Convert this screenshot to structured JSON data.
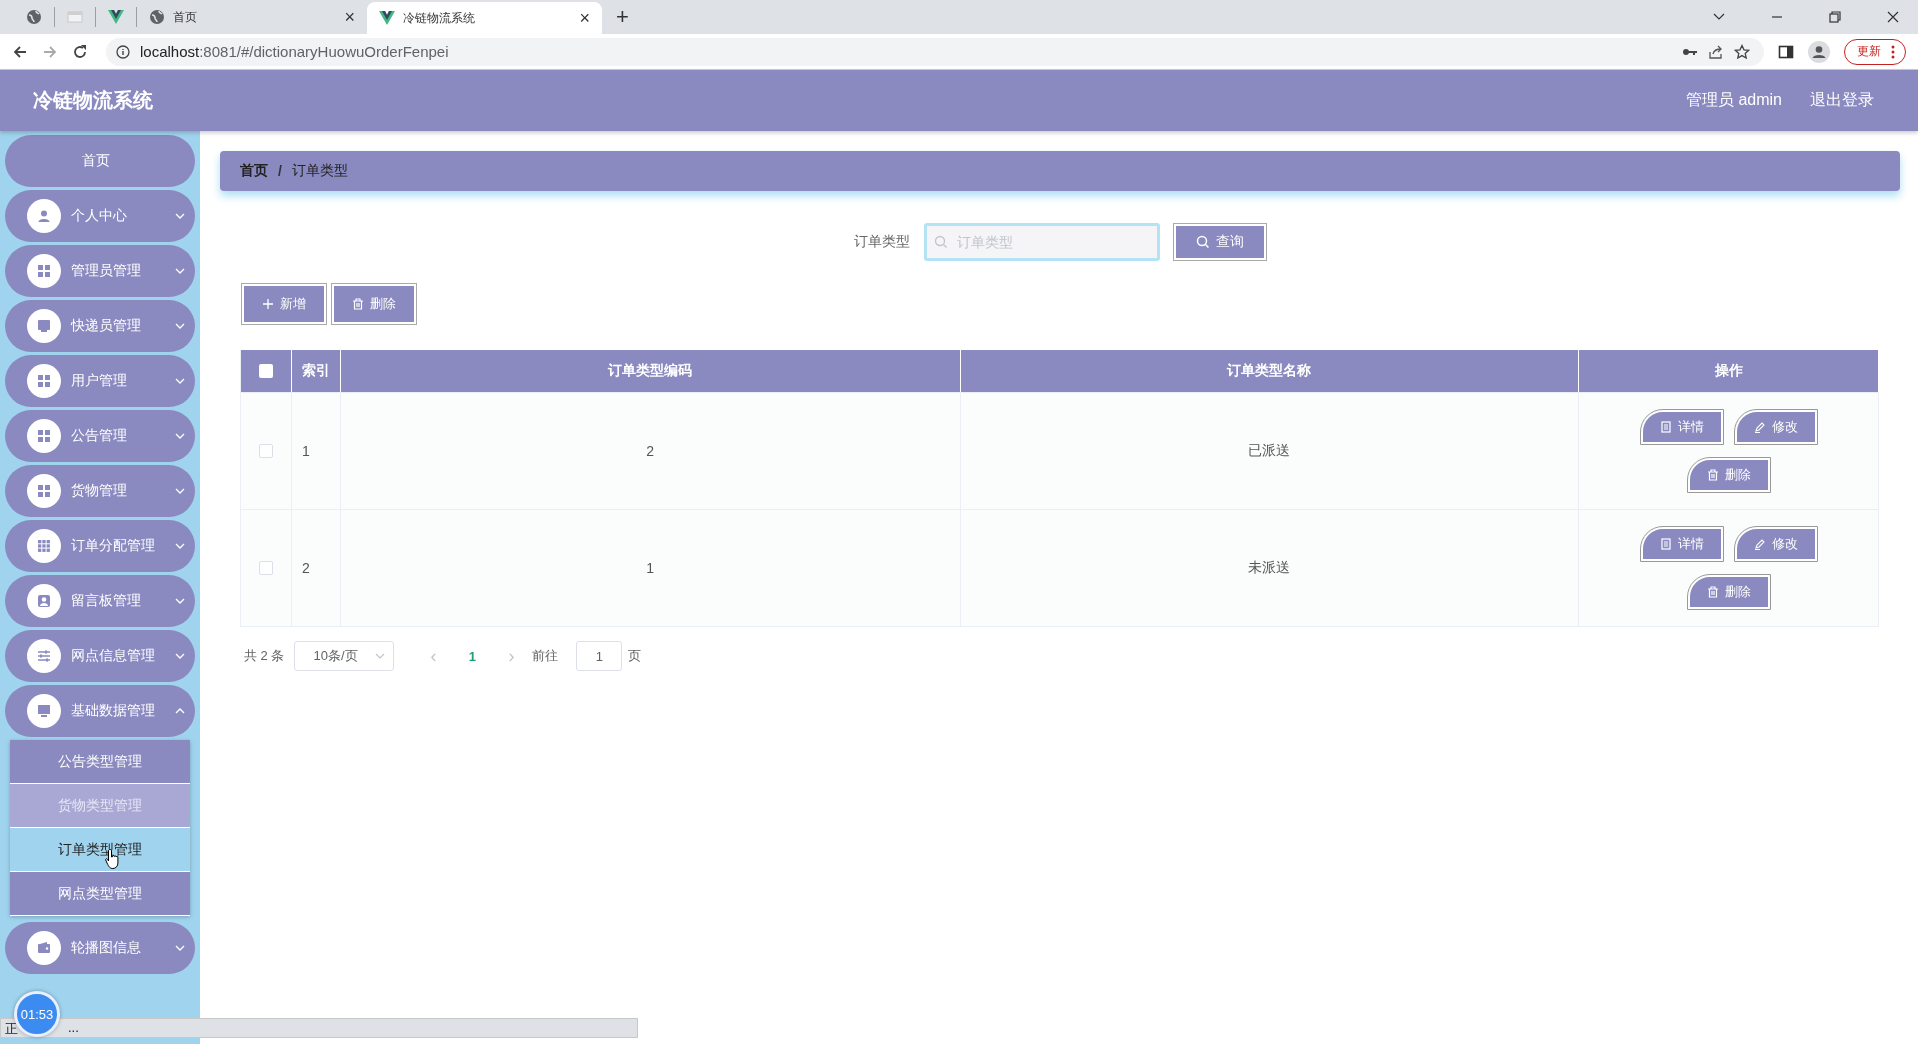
{
  "browser": {
    "tabs": [
      {
        "kind": "globe",
        "selected": false
      },
      {
        "kind": "page",
        "selected": false
      },
      {
        "kind": "vue",
        "selected": false
      },
      {
        "kind": "globe",
        "title": "首页",
        "close": "×",
        "selected": false
      },
      {
        "kind": "vue",
        "title": "冷链物流系统",
        "close": "×",
        "selected": true
      }
    ],
    "new_tab": "+",
    "address": {
      "host": "localhost",
      "rest": ":8081/#/dictionaryHuowuOrderFenpei"
    },
    "update_button": "更新"
  },
  "header": {
    "title": "冷链物流系统",
    "user": "管理员 admin",
    "logout": "退出登录"
  },
  "sidebar": {
    "items": [
      {
        "label": "首页",
        "kind": "plain"
      },
      {
        "label": "个人中心",
        "kind": "user",
        "expanded": false
      },
      {
        "label": "管理员管理",
        "kind": "grid",
        "expanded": false
      },
      {
        "label": "快递员管理",
        "kind": "inbox",
        "expanded": false
      },
      {
        "label": "用户管理",
        "kind": "grid",
        "expanded": false
      },
      {
        "label": "公告管理",
        "kind": "grid",
        "expanded": false
      },
      {
        "label": "货物管理",
        "kind": "grid",
        "expanded": false
      },
      {
        "label": "订单分配管理",
        "kind": "apps",
        "expanded": false
      },
      {
        "label": "留言板管理",
        "kind": "person",
        "expanded": false
      },
      {
        "label": "网点信息管理",
        "kind": "sliders",
        "expanded": false
      },
      {
        "label": "基础数据管理",
        "kind": "monitor",
        "expanded": true,
        "children": [
          {
            "label": "公告类型管理",
            "selected": false,
            "hovered": false
          },
          {
            "label": "货物类型管理",
            "selected": false,
            "hovered": true
          },
          {
            "label": "订单类型管理",
            "selected": true,
            "hovered": false
          },
          {
            "label": "网点类型管理",
            "selected": false,
            "hovered": false
          }
        ]
      },
      {
        "label": "轮播图信息",
        "kind": "wallet",
        "expanded": false
      }
    ]
  },
  "breadcrumb": {
    "items": [
      "首页",
      "订单类型"
    ],
    "separator": "/"
  },
  "search": {
    "label": "订单类型",
    "placeholder": "订单类型",
    "button": "查询"
  },
  "actions": [
    "新增",
    "删除"
  ],
  "table": {
    "all_checked": false,
    "columns": [
      "索引",
      "订单类型编码",
      "订单类型名称",
      "操作"
    ],
    "rows": [
      {
        "checked": false,
        "cells": [
          "1",
          "2",
          "已派送"
        ],
        "buttons": [
          "详情",
          "修改",
          "删除"
        ]
      },
      {
        "checked": false,
        "cells": [
          "2",
          "1",
          "未派送"
        ],
        "buttons": [
          "详情",
          "修改",
          "删除"
        ]
      }
    ]
  },
  "pagination": {
    "total": "共 2 条",
    "page_size": "10条/页",
    "prev": "‹",
    "current": "1",
    "next": "›",
    "goto_label": "前往",
    "goto_value": "1",
    "goto_suffix": "页"
  },
  "timer": "01:53",
  "status_bar": {
    "lead": "正",
    "tail": "..."
  }
}
